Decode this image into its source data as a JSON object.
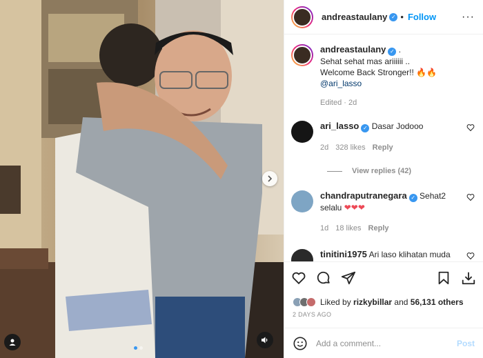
{
  "post": {
    "author": "andreastaulany",
    "follow_label": "Follow",
    "more_label": "···",
    "caption_lines": [
      "Sehat sehat mas ariiiiii ..",
      "Welcome Back Stronger!! 🔥🔥",
      "@ari_lasso"
    ],
    "caption_dot": ".",
    "edited": "Edited · 2d"
  },
  "comments": [
    {
      "user": "ari_lasso",
      "verified": true,
      "text": "Dasar Jodooo",
      "age": "2d",
      "likes": "328 likes",
      "reply": "Reply"
    },
    {
      "user": "chandraputranegara",
      "verified": true,
      "text": "Sehat2 selalu ❤️❤️❤️",
      "text_a": "Sehat2",
      "text_b": "selalu",
      "hearts": "❤❤❤",
      "age": "1d",
      "likes": "18 likes",
      "reply": "Reply"
    },
    {
      "user": "tinitini1975",
      "verified": false,
      "text": "Ari laso klihatan muda"
    }
  ],
  "view_replies": "View replies (42)",
  "liked_by": {
    "prefix": "Liked by",
    "user": "rizkybillar",
    "and": "and",
    "count": "56,131 others"
  },
  "posted_ago": "2 DAYS AGO",
  "add_comment": {
    "placeholder": "Add a comment...",
    "post_label": "Post"
  },
  "media": {
    "carousel": {
      "count": 2,
      "active": 1
    }
  },
  "colors": {
    "accent": "#0095f6",
    "verified": "#3897f0",
    "heart": "#ed4956"
  },
  "icons": [
    "like-icon",
    "comment-icon",
    "share-icon",
    "save-icon",
    "download-icon",
    "emoji-icon",
    "audio-icon",
    "user-tag-icon",
    "chevron-right-icon"
  ]
}
